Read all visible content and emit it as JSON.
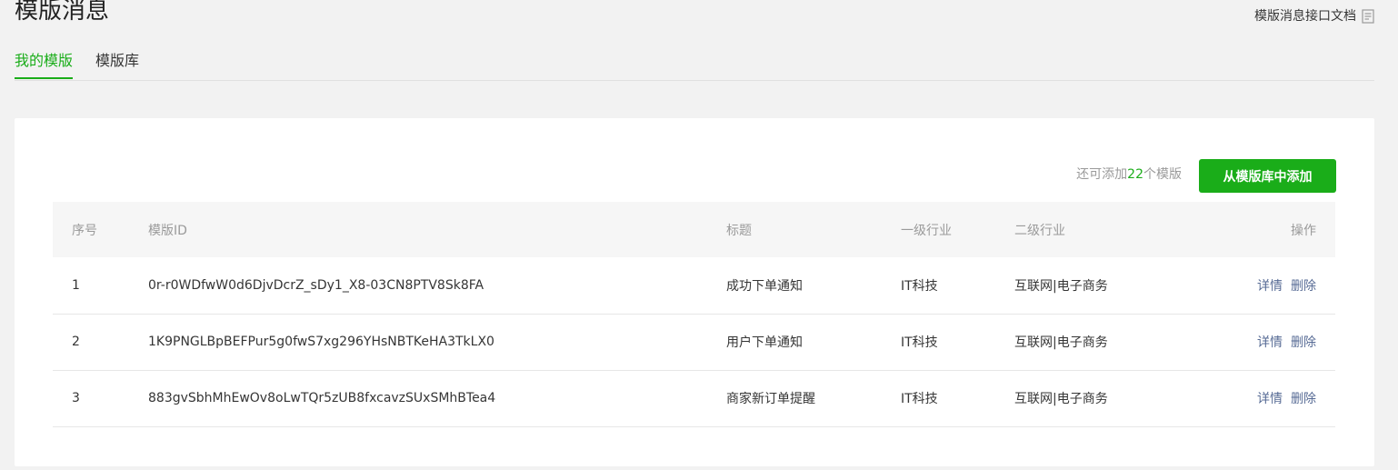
{
  "page": {
    "title": "模版消息",
    "doc_link_label": "模版消息接口文档"
  },
  "tabs": [
    {
      "label": "我的模版",
      "active": true
    },
    {
      "label": "模版库",
      "active": false
    }
  ],
  "quota": {
    "prefix": "还可添加",
    "count": "22",
    "suffix": "个模版"
  },
  "add_button_label": "从模版库中添加",
  "table": {
    "headers": [
      "序号",
      "模版ID",
      "标题",
      "一级行业",
      "二级行业",
      "操作"
    ],
    "rows": [
      {
        "seq": "1",
        "id": "0r-r0WDfwW0d6DjvDcrZ_sDy1_X8-03CN8PTV8Sk8FA",
        "title": "成功下单通知",
        "industry1": "IT科技",
        "industry2": "互联网|电子商务",
        "detail": "详情",
        "delete": "删除"
      },
      {
        "seq": "2",
        "id": "1K9PNGLBpBEFPur5g0fwS7xg296YHsNBTKeHA3TkLX0",
        "title": "用户下单通知",
        "industry1": "IT科技",
        "industry2": "互联网|电子商务",
        "detail": "详情",
        "delete": "删除"
      },
      {
        "seq": "3",
        "id": "883gvSbhMhEwOv8oLwTQr5zUB8fxcavzSUxSMhBTea4",
        "title": "商家新订单提醒",
        "industry1": "IT科技",
        "industry2": "互联网|电子商务",
        "detail": "详情",
        "delete": "删除"
      }
    ]
  },
  "colors": {
    "accent": "#1aad19",
    "link": "#576b95"
  },
  "icons": {
    "doc": "document-icon"
  }
}
